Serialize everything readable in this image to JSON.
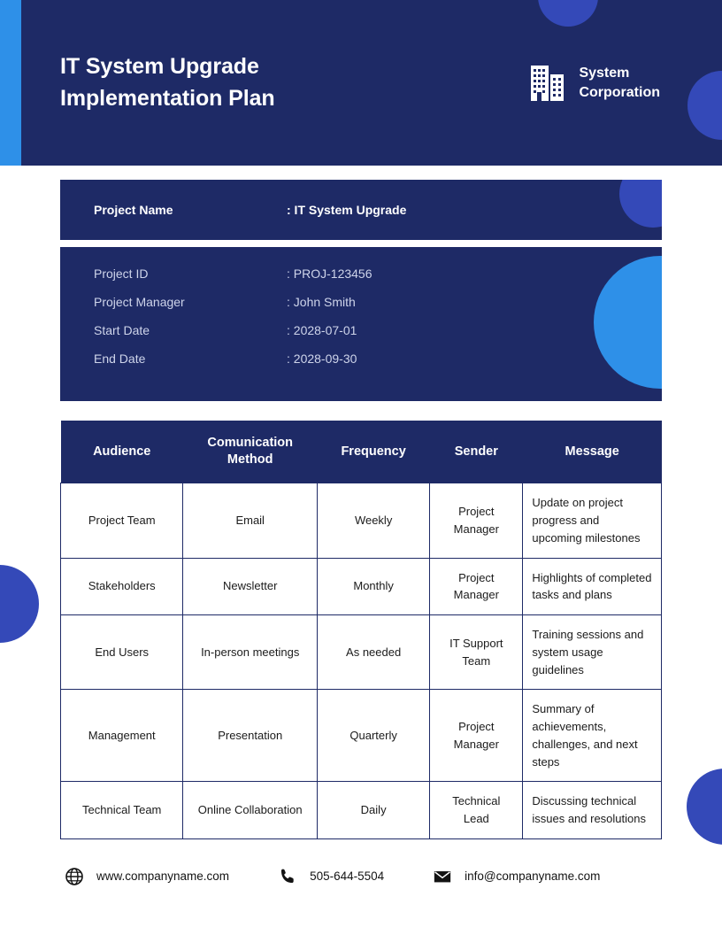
{
  "header": {
    "title": "IT System Upgrade Implementation Plan",
    "brand_name": "System\nCorporation",
    "logo_icon": "office-building-icon",
    "stripe_color": "#2e90e8",
    "background_color": "#1e2a66",
    "circle_color": "#3449b8"
  },
  "project_name_bar": {
    "label": "Project Name",
    "value": ": IT System Upgrade"
  },
  "project_details": {
    "rows": [
      {
        "label": "Project ID",
        "value": ": PROJ-123456"
      },
      {
        "label": "Project Manager",
        "value": ": John Smith"
      },
      {
        "label": "Start Date",
        "value": ": 2028-07-01"
      },
      {
        "label": "End Date",
        "value": ": 2028-09-30"
      }
    ],
    "accent_circle_color": "#2e90e8"
  },
  "communication_table": {
    "columns": [
      "Audience",
      "Comunication Method",
      "Frequency",
      "Sender",
      "Message"
    ],
    "rows": [
      {
        "audience": "Project Team",
        "method": "Email",
        "frequency": "Weekly",
        "sender": "Project Manager",
        "message": "Update on project progress and upcoming milestones"
      },
      {
        "audience": "Stakeholders",
        "method": "Newsletter",
        "frequency": "Monthly",
        "sender": "Project Manager",
        "message": "Highlights of completed tasks and plans"
      },
      {
        "audience": "End Users",
        "method": "In-person meetings",
        "frequency": "As needed",
        "sender": "IT Support Team",
        "message": "Training sessions and system usage guidelines"
      },
      {
        "audience": "Management",
        "method": "Presentation",
        "frequency": "Quarterly",
        "sender": "Project Manager",
        "message": "Summary of achievements, challenges, and next steps"
      },
      {
        "audience": "Technical Team",
        "method": "Online Collaboration",
        "frequency": "Daily",
        "sender": "Technical Lead",
        "message": "Discussing technical issues and resolutions"
      }
    ]
  },
  "footer": {
    "website": "www.companyname.com",
    "phone": "505-644-5504",
    "email": "info@companyname.com",
    "website_icon": "globe-icon",
    "phone_icon": "phone-icon",
    "email_icon": "envelope-icon"
  }
}
